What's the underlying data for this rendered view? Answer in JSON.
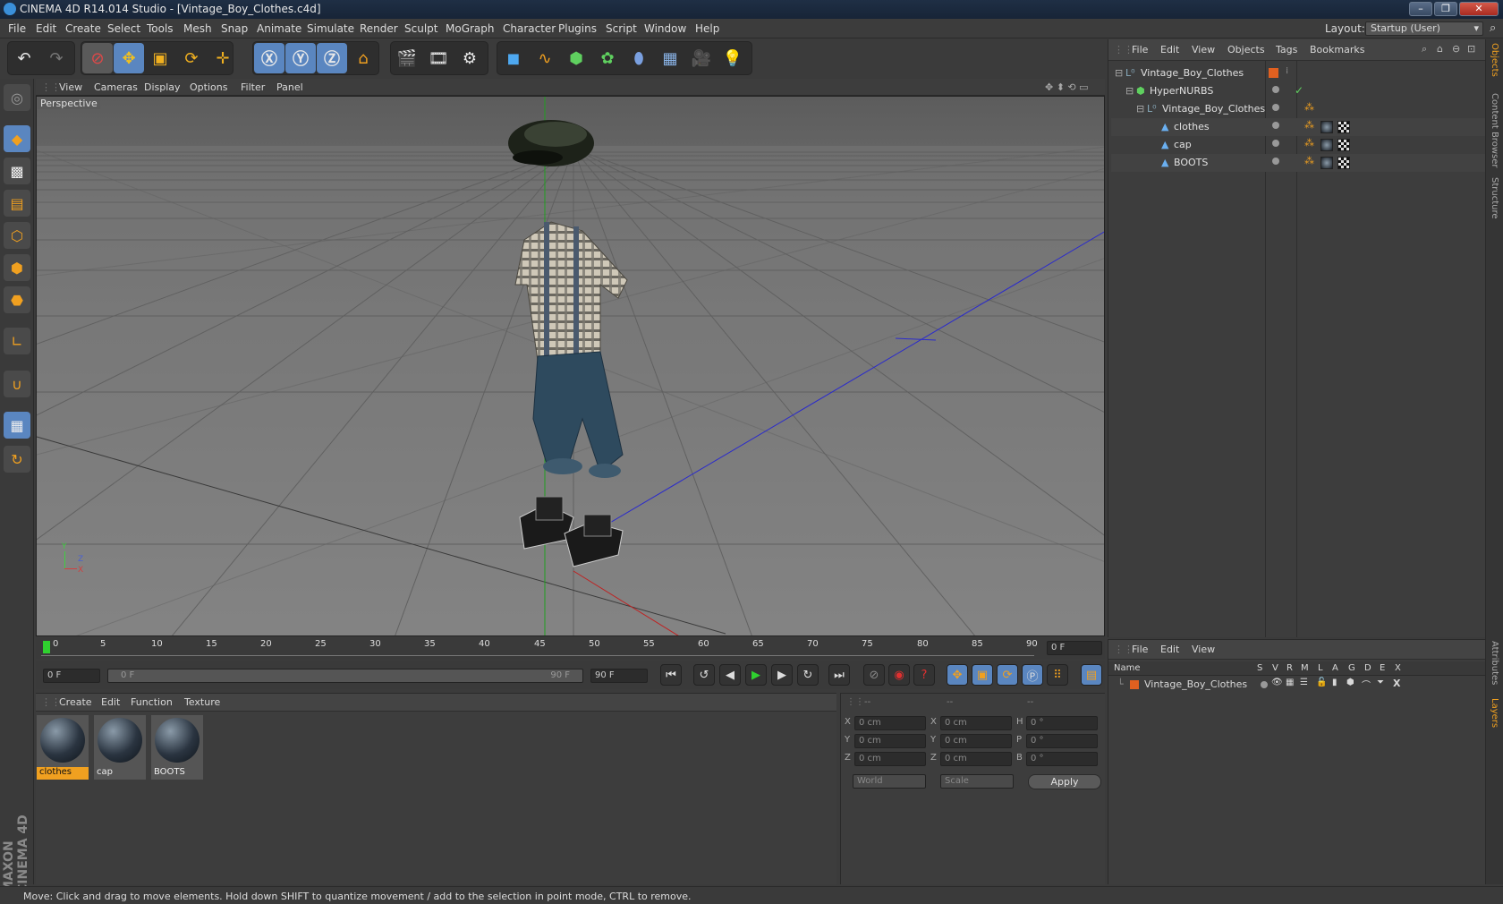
{
  "window": {
    "title": "CINEMA 4D R14.014 Studio - [Vintage_Boy_Clothes.c4d]",
    "layout_label": "Layout:",
    "layout_value": "Startup (User)"
  },
  "menu": [
    "File",
    "Edit",
    "Create",
    "Select",
    "Tools",
    "Mesh",
    "Snap",
    "Animate",
    "Simulate",
    "Render",
    "Sculpt",
    "MoGraph",
    "Character",
    "Plugins",
    "Script",
    "Window",
    "Help"
  ],
  "viewport": {
    "menu": [
      "View",
      "Cameras",
      "Display",
      "Options",
      "Filter",
      "Panel"
    ],
    "label": "Perspective",
    "axis": {
      "x": "X",
      "y": "Y",
      "z": "Z"
    }
  },
  "timeline": {
    "ticks": [
      "0",
      "5",
      "10",
      "15",
      "20",
      "25",
      "30",
      "35",
      "40",
      "45",
      "50",
      "55",
      "60",
      "65",
      "70",
      "75",
      "80",
      "85",
      "90"
    ],
    "current_frame": "0 F",
    "start_field": "0 F",
    "slider_start": "0 F",
    "slider_end": "90 F",
    "end_field": "90 F"
  },
  "materials": {
    "menu": [
      "Create",
      "Edit",
      "Function",
      "Texture"
    ],
    "items": [
      {
        "name": "clothes",
        "selected": true
      },
      {
        "name": "cap",
        "selected": false
      },
      {
        "name": "BOOTS",
        "selected": false
      }
    ]
  },
  "coordinates": {
    "header": [
      "--",
      "--",
      "--"
    ],
    "rows": [
      {
        "a": "X",
        "a_val": "0 cm",
        "b": "X",
        "b_val": "0 cm",
        "c": "H",
        "c_val": "0 °"
      },
      {
        "a": "Y",
        "a_val": "0 cm",
        "b": "Y",
        "b_val": "0 cm",
        "c": "P",
        "c_val": "0 °"
      },
      {
        "a": "Z",
        "a_val": "0 cm",
        "b": "Z",
        "b_val": "0 cm",
        "c": "B",
        "c_val": "0 °"
      }
    ],
    "world": "World",
    "scale": "Scale",
    "apply": "Apply"
  },
  "objects": {
    "menu": [
      "File",
      "Edit",
      "View",
      "Objects",
      "Tags",
      "Bookmarks"
    ],
    "tree": [
      {
        "name": "Vintage_Boy_Clothes",
        "depth": 0
      },
      {
        "name": "HyperNURBS",
        "depth": 1
      },
      {
        "name": "Vintage_Boy_Clothes",
        "depth": 2
      },
      {
        "name": "clothes",
        "depth": 3
      },
      {
        "name": "cap",
        "depth": 3
      },
      {
        "name": "BOOTS",
        "depth": 3
      }
    ]
  },
  "layers": {
    "menu": [
      "File",
      "Edit",
      "View"
    ],
    "columns": [
      "Name",
      "S",
      "V",
      "R",
      "M",
      "L",
      "A",
      "G",
      "D",
      "E",
      "X"
    ],
    "rows": [
      {
        "name": "Vintage_Boy_Clothes"
      }
    ]
  },
  "side_tabs": {
    "top": [
      "Objects",
      "Content Browser",
      "Structure"
    ],
    "bottom": [
      "Attributes",
      "Layers"
    ]
  },
  "brand": "MAXON CINEMA 4D",
  "status": "Move: Click and drag to move elements. Hold down SHIFT to quantize movement / add to the selection in point mode, CTRL to remove.",
  "colors": {
    "accent_orange": "#f0a020",
    "selection_blue": "#3a6ea8",
    "play_green": "#2fd12f"
  }
}
